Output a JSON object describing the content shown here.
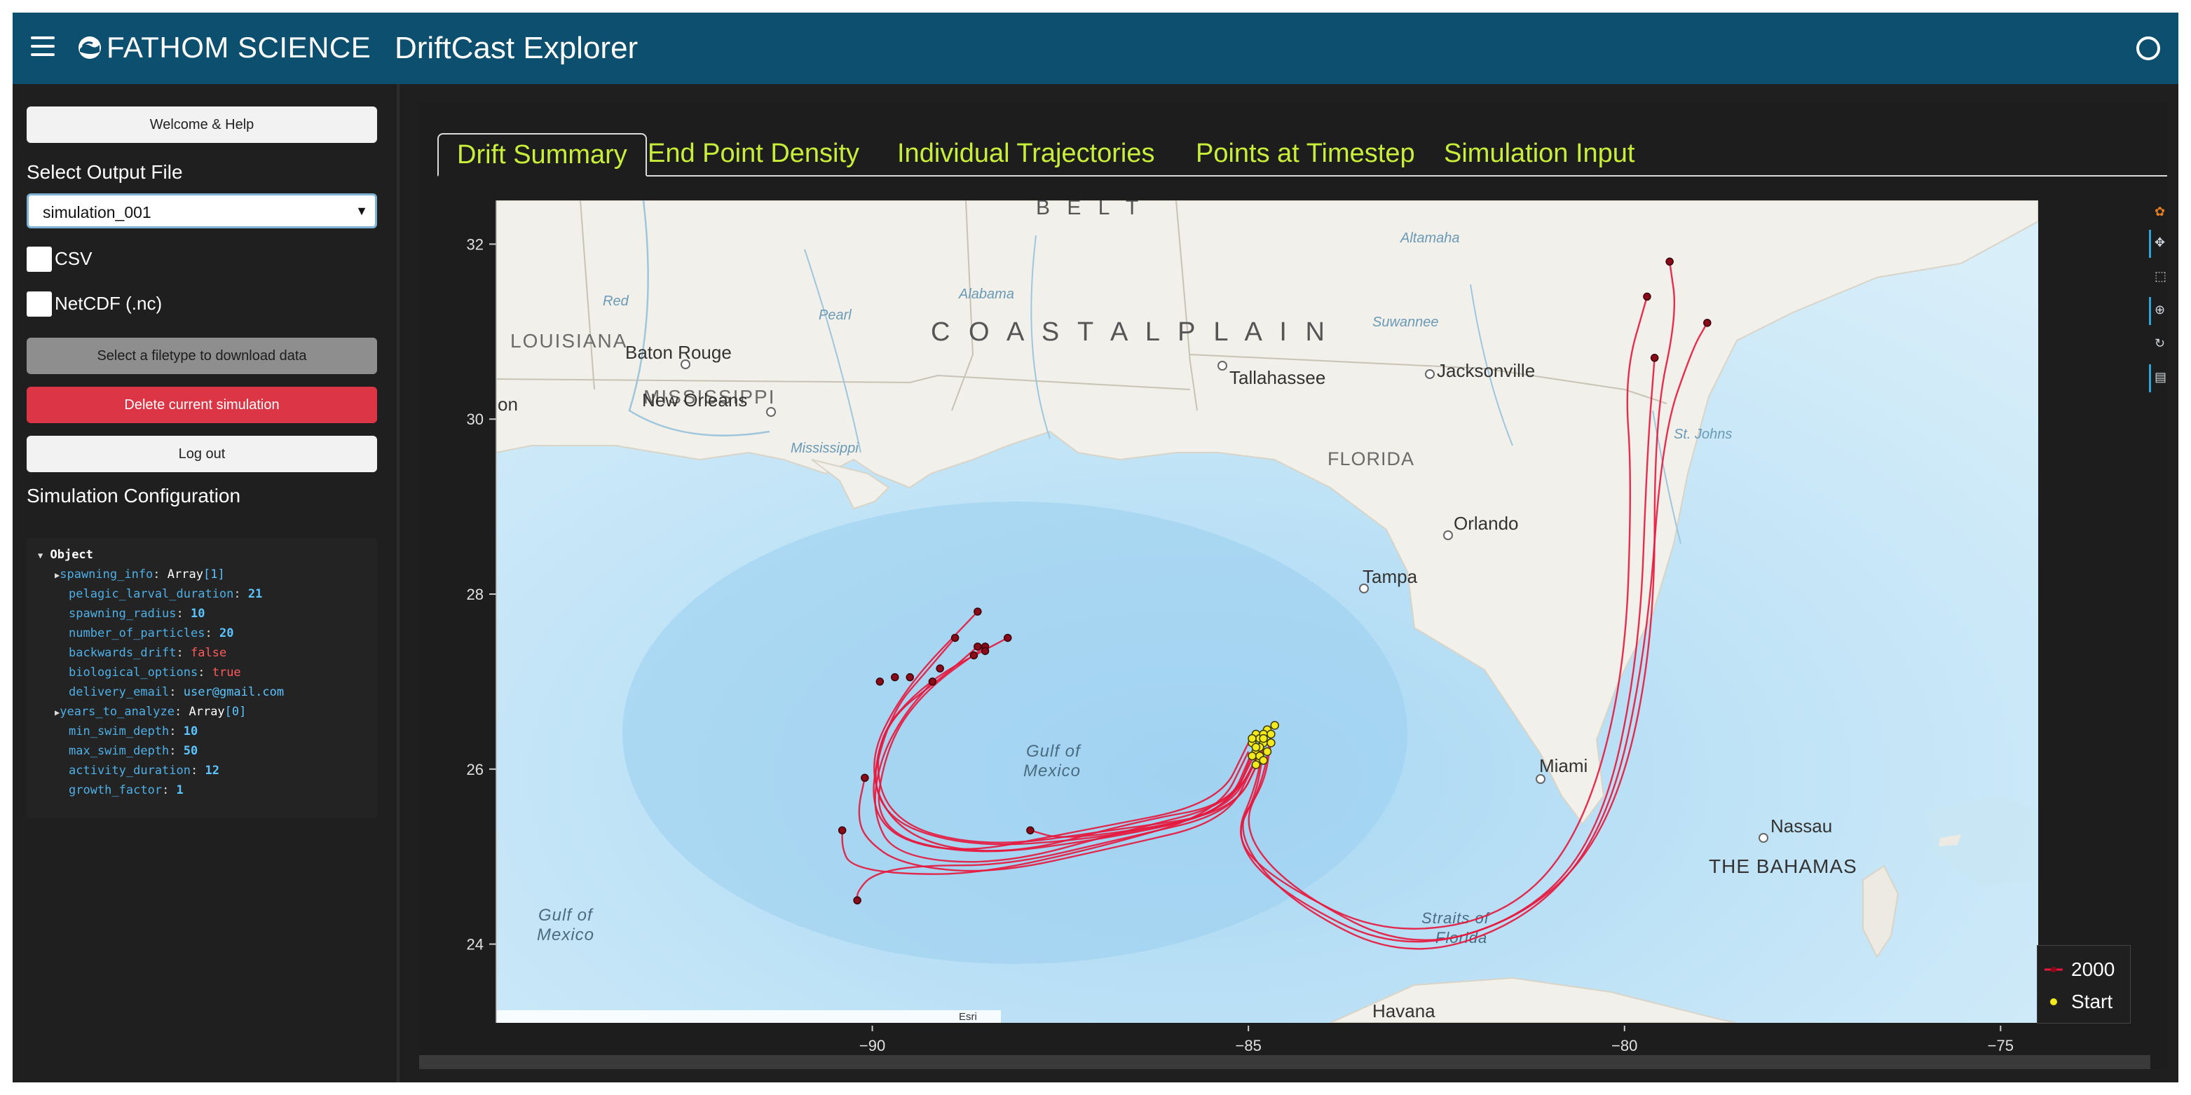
{
  "header": {
    "brand_name": "FATHOM SCIENCE",
    "app_title": "DriftCast Explorer"
  },
  "sidebar": {
    "welcome_label": "Welcome & Help",
    "select_output_label": "Select Output File",
    "selected_file": "simulation_001",
    "csv_label": "CSV",
    "netcdf_label": "NetCDF (.nc)",
    "download_label": "Select a filetype to download data",
    "delete_label": "Delete current simulation",
    "logout_label": "Log out",
    "config_label": "Simulation Configuration",
    "config": {
      "root": "Object",
      "spawning_info_key": "spawning_info",
      "spawning_info_type": "Array",
      "spawning_info_count": "[1]",
      "pelagic_larval_duration_key": "pelagic_larval_duration",
      "pelagic_larval_duration": "21",
      "spawning_radius_key": "spawning_radius",
      "spawning_radius": "10",
      "number_of_particles_key": "number_of_particles",
      "number_of_particles": "20",
      "backwards_drift_key": "backwards_drift",
      "backwards_drift": "false",
      "biological_options_key": "biological_options",
      "biological_options": "true",
      "delivery_email_key": "delivery_email",
      "delivery_email": "user@gmail.com",
      "years_to_analyze_key": "years_to_analyze",
      "years_to_analyze_type": "Array",
      "years_to_analyze_count": "[0]",
      "min_swim_depth_key": "min_swim_depth",
      "min_swim_depth": "10",
      "max_swim_depth_key": "max_swim_depth",
      "max_swim_depth": "50",
      "activity_duration_key": "activity_duration",
      "activity_duration": "12",
      "growth_factor_key": "growth_factor",
      "growth_factor": "1"
    }
  },
  "tabs": [
    {
      "label": "Drift Summary",
      "active": true
    },
    {
      "label": "End Point Density",
      "active": false
    },
    {
      "label": "Individual Trajectories",
      "active": false
    },
    {
      "label": "Points at Timestep",
      "active": false
    },
    {
      "label": "Simulation Input",
      "active": false
    }
  ],
  "map": {
    "attribution": "Esri",
    "labels": [
      {
        "text": "LOUISIANA"
      },
      {
        "text": "MISSISSIPPI"
      },
      {
        "text": "C O A S T A L   P L A I N"
      },
      {
        "text": "B E L T"
      },
      {
        "text": "Jackson"
      },
      {
        "text": "Baton Rouge"
      },
      {
        "text": "New Orleans"
      },
      {
        "text": "Tallahassee"
      },
      {
        "text": "Jacksonville"
      },
      {
        "text": "FLORIDA"
      },
      {
        "text": "Orlando"
      },
      {
        "text": "Tampa"
      },
      {
        "text": "Gulf of"
      },
      {
        "text": "Mexico"
      },
      {
        "text": "Gulf of"
      },
      {
        "text": "Mexico"
      },
      {
        "text": "Miami"
      },
      {
        "text": "Nassau"
      },
      {
        "text": "THE BAHAMAS"
      },
      {
        "text": "Straits of"
      },
      {
        "text": "Florida"
      },
      {
        "text": "Havana"
      },
      {
        "text": "on"
      },
      {
        "text": "Red"
      },
      {
        "text": "Pearl"
      },
      {
        "text": "Alabama"
      },
      {
        "text": "Altamaha"
      },
      {
        "text": "Suwannee"
      },
      {
        "text": "St. Johns"
      },
      {
        "text": "Mississippi"
      }
    ]
  },
  "chart_data": {
    "type": "line",
    "title": "",
    "xlabel": "",
    "ylabel": "",
    "xlim": [
      -95,
      -74.5
    ],
    "ylim": [
      23.1,
      32.5
    ],
    "xticks": [
      -90,
      -85,
      -80,
      -75
    ],
    "yticks": [
      24,
      26,
      28,
      30,
      32
    ],
    "grid": false,
    "legend_position": "bottom-right",
    "colors": {
      "trajectory": "#e8163c",
      "start": "#f2ea1a",
      "end": "#8b0a1a"
    },
    "series": [
      {
        "name": "2000",
        "trajectories": [
          [
            [
              -84.9,
              26.3
            ],
            [
              -85.2,
              25.6
            ],
            [
              -86.5,
              25.4
            ],
            [
              -88.2,
              25.0
            ],
            [
              -89.6,
              25.2
            ],
            [
              -90.1,
              26.0
            ],
            [
              -89.6,
              26.9
            ],
            [
              -88.6,
              27.8
            ]
          ],
          [
            [
              -84.8,
              26.2
            ],
            [
              -85.2,
              25.5
            ],
            [
              -86.8,
              25.3
            ],
            [
              -88.5,
              25.1
            ],
            [
              -89.8,
              25.4
            ],
            [
              -90.0,
              26.3
            ],
            [
              -89.3,
              27.0
            ],
            [
              -88.2,
              27.5
            ]
          ],
          [
            [
              -84.9,
              26.1
            ],
            [
              -85.3,
              25.5
            ],
            [
              -87.0,
              25.2
            ],
            [
              -88.8,
              25.1
            ],
            [
              -90.0,
              25.5
            ],
            [
              -89.9,
              26.5
            ],
            [
              -89.0,
              27.1
            ],
            [
              -88.6,
              27.4
            ]
          ],
          [
            [
              -85.0,
              26.3
            ],
            [
              -85.4,
              25.6
            ],
            [
              -87.2,
              25.3
            ],
            [
              -89.0,
              25.0
            ],
            [
              -90.1,
              25.4
            ],
            [
              -89.8,
              26.6
            ],
            [
              -89.2,
              27.2
            ],
            [
              -88.9,
              27.5
            ]
          ],
          [
            [
              -84.9,
              26.2
            ],
            [
              -85.3,
              25.5
            ],
            [
              -86.9,
              25.2
            ],
            [
              -88.7,
              25.0
            ],
            [
              -90.0,
              25.3
            ],
            [
              -89.8,
              26.3
            ],
            [
              -89.3,
              26.9
            ],
            [
              -88.5,
              27.4
            ]
          ],
          [
            [
              -84.8,
              26.3
            ],
            [
              -85.2,
              25.6
            ],
            [
              -86.6,
              25.3
            ],
            [
              -88.3,
              24.9
            ],
            [
              -89.7,
              25.0
            ],
            [
              -90.0,
              25.5
            ],
            [
              -89.9,
              26.1
            ],
            [
              -89.6,
              26.6
            ],
            [
              -89.2,
              27.0
            ]
          ],
          [
            [
              -84.9,
              26.1
            ],
            [
              -85.3,
              25.4
            ],
            [
              -86.8,
              25.1
            ],
            [
              -88.4,
              24.8
            ],
            [
              -89.6,
              24.9
            ],
            [
              -90.1,
              25.2
            ],
            [
              -90.2,
              25.5
            ],
            [
              -90.1,
              25.9
            ]
          ],
          [
            [
              -85.0,
              26.2
            ],
            [
              -85.4,
              25.5
            ],
            [
              -87.0,
              25.1
            ],
            [
              -88.6,
              24.8
            ],
            [
              -89.7,
              24.8
            ],
            [
              -90.3,
              24.9
            ],
            [
              -90.4,
              25.1
            ],
            [
              -90.4,
              25.3
            ]
          ],
          [
            [
              -84.8,
              26.2
            ],
            [
              -85.2,
              25.5
            ],
            [
              -86.7,
              25.2
            ],
            [
              -88.2,
              24.9
            ],
            [
              -89.4,
              24.9
            ],
            [
              -90.0,
              24.8
            ],
            [
              -90.2,
              24.6
            ],
            [
              -90.2,
              24.5
            ]
          ],
          [
            [
              -84.9,
              26.3
            ],
            [
              -85.3,
              25.5
            ],
            [
              -86.5,
              25.3
            ],
            [
              -87.5,
              25.2
            ],
            [
              -87.9,
              25.3
            ]
          ],
          [
            [
              -84.7,
              26.4
            ],
            [
              -84.8,
              25.9
            ],
            [
              -85.1,
              25.3
            ],
            [
              -84.4,
              24.6
            ],
            [
              -82.8,
              23.9
            ],
            [
              -81.1,
              24.4
            ],
            [
              -80.1,
              25.5
            ],
            [
              -79.6,
              27.5
            ],
            [
              -79.6,
              30.0
            ],
            [
              -79.3,
              31.2
            ],
            [
              -79.4,
              31.8
            ]
          ],
          [
            [
              -84.8,
              26.3
            ],
            [
              -84.9,
              25.8
            ],
            [
              -85.2,
              25.2
            ],
            [
              -84.6,
              24.6
            ],
            [
              -83.0,
              23.9
            ],
            [
              -81.3,
              24.3
            ],
            [
              -80.3,
              25.3
            ],
            [
              -79.8,
              27.3
            ],
            [
              -79.7,
              29.6
            ],
            [
              -79.6,
              30.7
            ]
          ],
          [
            [
              -84.8,
              26.2
            ],
            [
              -84.9,
              25.7
            ],
            [
              -85.2,
              25.2
            ],
            [
              -84.6,
              24.7
            ],
            [
              -83.2,
              24.1
            ],
            [
              -81.6,
              24.3
            ],
            [
              -80.6,
              25.2
            ],
            [
              -80.0,
              27.0
            ],
            [
              -79.9,
              29.3
            ],
            [
              -80.0,
              30.5
            ],
            [
              -79.7,
              31.4
            ]
          ],
          [
            [
              -84.7,
              26.3
            ],
            [
              -84.8,
              25.8
            ],
            [
              -85.2,
              25.3
            ],
            [
              -84.5,
              24.5
            ],
            [
              -82.9,
              23.8
            ],
            [
              -81.2,
              24.3
            ],
            [
              -80.2,
              25.4
            ],
            [
              -79.7,
              27.4
            ],
            [
              -79.5,
              29.8
            ],
            [
              -79.1,
              30.8
            ],
            [
              -78.9,
              31.1
            ]
          ]
        ]
      }
    ],
    "start_points": {
      "name": "Start",
      "x": [
        -84.95,
        -84.9,
        -84.85,
        -84.8,
        -84.75,
        -84.9,
        -84.85,
        -84.8,
        -84.95,
        -84.7,
        -84.85,
        -84.9,
        -84.75,
        -84.8,
        -84.65,
        -84.9,
        -84.85,
        -84.95,
        -84.8,
        -84.7
      ],
      "y": [
        26.3,
        26.4,
        26.35,
        26.3,
        26.45,
        26.2,
        26.25,
        26.4,
        26.15,
        26.3,
        26.1,
        26.05,
        26.2,
        26.35,
        26.5,
        26.25,
        26.15,
        26.35,
        26.1,
        26.4
      ]
    },
    "end_points": {
      "x": [
        -88.6,
        -88.2,
        -88.6,
        -88.9,
        -88.5,
        -89.2,
        -90.1,
        -90.4,
        -90.2,
        -87.9,
        -79.4,
        -79.6,
        -79.7,
        -78.9,
        -89.5,
        -89.9,
        -89.1,
        -89.7,
        -88.5,
        -88.65
      ],
      "y": [
        27.8,
        27.5,
        27.4,
        27.5,
        27.4,
        27.0,
        25.9,
        25.3,
        24.5,
        25.3,
        31.8,
        30.7,
        31.4,
        31.1,
        27.05,
        27.0,
        27.15,
        27.05,
        27.35,
        27.3
      ]
    }
  }
}
